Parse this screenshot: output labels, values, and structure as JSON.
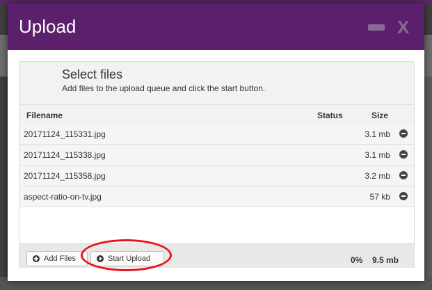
{
  "dialog": {
    "title": "Upload"
  },
  "uploader": {
    "heading": "Select files",
    "description": "Add files to the upload queue and click the start button.",
    "columns": {
      "filename": "Filename",
      "status": "Status",
      "size": "Size"
    },
    "files": [
      {
        "name": "20171124_115331.jpg",
        "status": "",
        "size": "3.1 mb"
      },
      {
        "name": "20171124_115338.jpg",
        "status": "",
        "size": "3.1 mb"
      },
      {
        "name": "20171124_115358.jpg",
        "status": "",
        "size": "3.2 mb"
      },
      {
        "name": "aspect-ratio-on-tv.jpg",
        "status": "",
        "size": "57 kb"
      }
    ],
    "add_files_label": "Add Files",
    "start_upload_label": "Start Upload",
    "progress_percent": "0%",
    "total_size": "9.5 mb"
  },
  "colors": {
    "titlebar": "#5c1f6b",
    "highlight": "#e8141e"
  }
}
